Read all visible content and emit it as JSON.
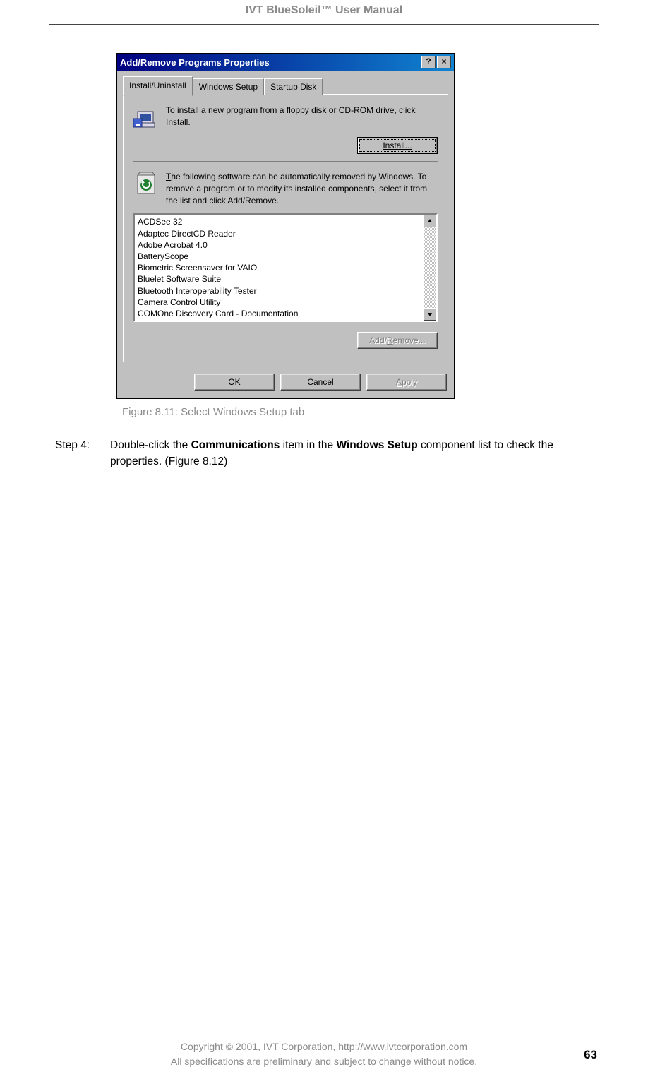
{
  "header": {
    "title": "IVT BlueSoleil™ User Manual"
  },
  "dialog": {
    "title": "Add/Remove Programs Properties",
    "help_btn": "?",
    "close_btn": "×",
    "tabs": [
      "Install/Uninstall",
      "Windows Setup",
      "Startup Disk"
    ],
    "install_text": "To install a new program from a floppy disk or CD-ROM drive, click Install.",
    "install_btn": "Install...",
    "remove_text_pre": "T",
    "remove_text": "he following software can be automatically removed by Windows. To remove a program or to modify its installed components, select it from the list and click Add/Remove.",
    "list": [
      "ACDSee 32",
      "Adaptec DirectCD Reader",
      "Adobe Acrobat 4.0",
      "BatteryScope",
      "Biometric Screensaver for VAIO",
      "Bluelet Software Suite",
      "Bluetooth Interoperability Tester",
      "Camera Control Utility",
      "COMOne Discovery Card - Documentation"
    ],
    "addremove_btn_pre": "Add/",
    "addremove_btn_u": "R",
    "addremove_btn_post": "emove...",
    "ok": "OK",
    "cancel": "Cancel",
    "apply_u": "A",
    "apply_post": "pply"
  },
  "caption": "Figure 8.11: Select Windows Setup tab",
  "step": {
    "label": "Step 4:",
    "pre": "Double-click the ",
    "b1": "Communications",
    "mid": " item in the ",
    "b2": "Windows Setup",
    "post": " component list to check the properties. (Figure 8.12)"
  },
  "footer": {
    "line1_pre": "Copyright © 2001, IVT Corporation, ",
    "line1_link": "http://www.ivtcorporation.com",
    "line2": "All specifications are preliminary and subject to change without notice.",
    "page": "63"
  }
}
